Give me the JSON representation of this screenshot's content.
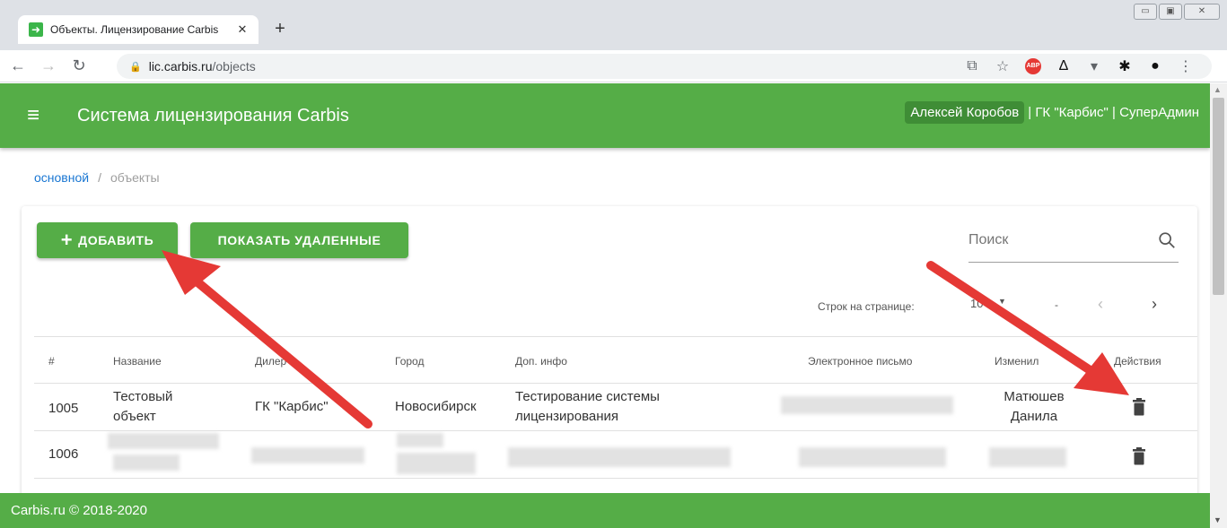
{
  "browser": {
    "tab_title": "Объекты. Лицензирование Carbis",
    "tab_close": "✕",
    "new_tab": "+",
    "url_host": "lic.carbis.ru",
    "url_path": "/objects"
  },
  "app": {
    "title": "Система лицензирования Carbis",
    "user_name": "Алексей Коробов",
    "user_rest": "| ГК \"Карбис\" | СуперАдмин",
    "accent": "#55ad47"
  },
  "breadcrumb": {
    "root": "основной",
    "sep": "/",
    "current": "объекты"
  },
  "toolbar": {
    "add_label": "ДОБАВИТЬ",
    "add_plus": "+",
    "show_deleted_label": "ПОКАЗАТЬ УДАЛЕННЫЕ",
    "search_placeholder": "Поиск"
  },
  "pager": {
    "rows_label": "Строк на странице:",
    "rows_value": "10",
    "range": "-"
  },
  "table": {
    "headers": {
      "id": "#",
      "name": "Название",
      "dealer": "Дилер",
      "city": "Город",
      "info": "Доп. инфо",
      "email": "Электронное письмо",
      "changed": "Изменил",
      "actions": "Действия"
    },
    "rows": [
      {
        "id": "1005",
        "name_line1": "Тестовый",
        "name_line2": "объект",
        "dealer": "ГК \"Карбис\"",
        "city": "Новосибирск",
        "info_line1": "Тестирование системы",
        "info_line2": "лицензирования",
        "changed_line1": "Матюшев",
        "changed_line2": "Данила"
      },
      {
        "id": "1006"
      }
    ]
  },
  "footer": {
    "text": "Carbis.ru © 2018-2020"
  }
}
